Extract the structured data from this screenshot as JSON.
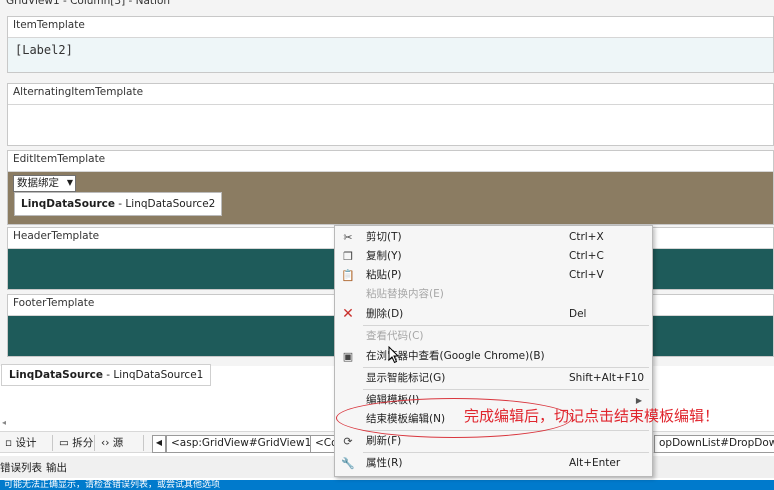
{
  "gridview_title": "GridView1 - Column[3] - Nation",
  "templates": {
    "item": {
      "label": "ItemTemplate",
      "content": "[Label2]"
    },
    "alternating": {
      "label": "AlternatingItemTemplate"
    },
    "edit": {
      "label": "EditItemTemplate",
      "dropdown": "数据绑定",
      "datasource_bold": "LinqDataSource",
      "datasource_rest": " - LinqDataSource2"
    },
    "header": {
      "label": "HeaderTemplate"
    },
    "footer": {
      "label": "FooterTemplate"
    }
  },
  "bottom_datasource": {
    "bold": "LinqDataSource",
    "rest": " - LinqDataSource1"
  },
  "view_bar": {
    "design": "设计",
    "split": "拆分",
    "source": "源",
    "crumb1": "<asp:GridView#GridView1>",
    "crumb2": "<Co",
    "crumb_right": "opDownList#DropDow...>"
  },
  "panel_tabs": {
    "errors": "错误列表",
    "output": "输出"
  },
  "status_text": "可能无法正确显示，请检查错误列表，或尝试其他选项",
  "context_menu": {
    "items": [
      {
        "label": "剪切(T)",
        "shortcut": "Ctrl+X"
      },
      {
        "label": "复制(Y)",
        "shortcut": "Ctrl+C"
      },
      {
        "label": "粘贴(P)",
        "shortcut": "Ctrl+V"
      },
      {
        "label": "粘贴替换内容(E)",
        "shortcut": ""
      },
      {
        "label": "删除(D)",
        "shortcut": "Del"
      },
      {
        "label": "查看代码(C)",
        "shortcut": ""
      },
      {
        "label": "在浏览器中查看(Google Chrome)(B)",
        "shortcut": ""
      },
      {
        "label": "显示智能标记(G)",
        "shortcut": "Shift+Alt+F10"
      },
      {
        "label": "编辑模板(I)",
        "shortcut": ""
      },
      {
        "label": "结束模板编辑(N)",
        "shortcut": ""
      },
      {
        "label": "刷新(F)",
        "shortcut": ""
      },
      {
        "label": "属性(R)",
        "shortcut": "Alt+Enter"
      }
    ]
  },
  "annotation": "完成编辑后，切记点击结束模板编辑！",
  "colors": {
    "edit_bg": "#8b7c62",
    "teal_bg": "#1e5b5a",
    "annotation": "#e0262e",
    "status_bar": "#007acc"
  }
}
